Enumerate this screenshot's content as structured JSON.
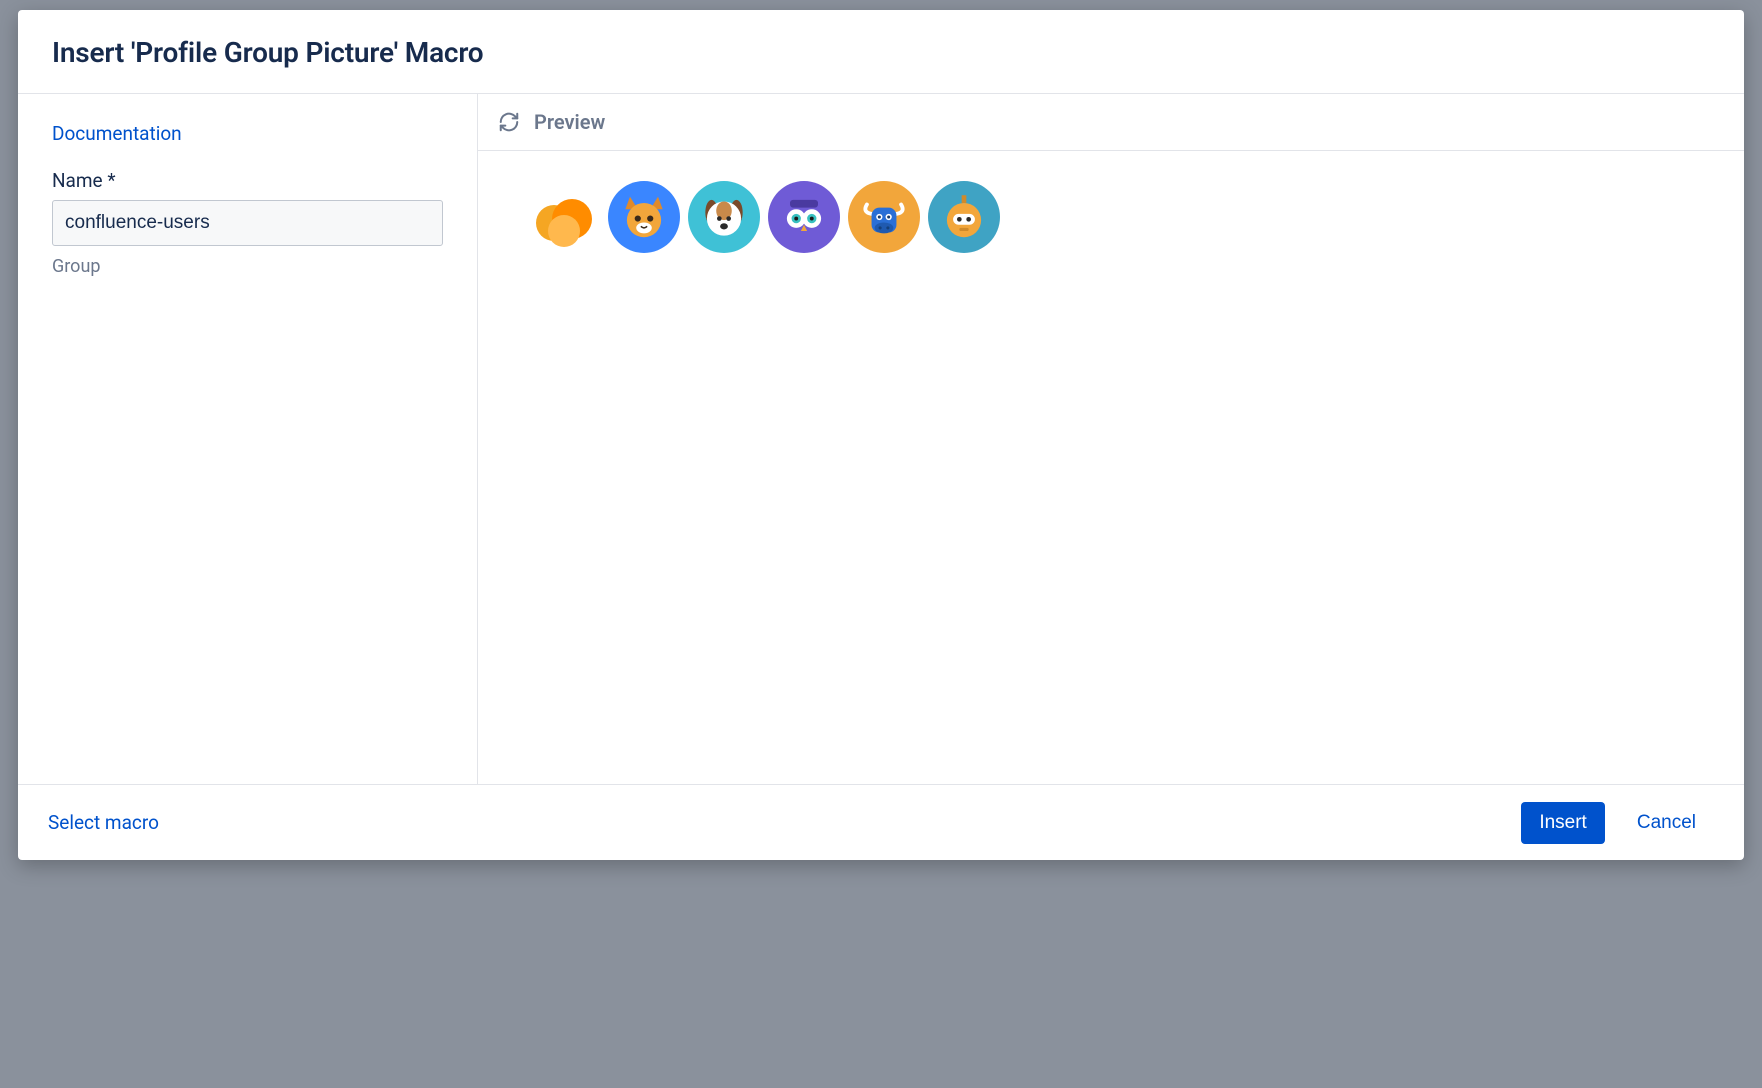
{
  "dialog": {
    "title": "Insert 'Profile Group Picture' Macro"
  },
  "form": {
    "documentation_link": "Documentation",
    "name_label": "Name *",
    "name_value": "confluence-users",
    "name_help": "Group"
  },
  "preview": {
    "heading": "Preview",
    "avatars": [
      {
        "name": "cloud-avatar",
        "bg": "transparent"
      },
      {
        "name": "cat-avatar",
        "bg": "#3a86ff"
      },
      {
        "name": "dog-avatar",
        "bg": "#3fc1d6"
      },
      {
        "name": "owl-avatar",
        "bg": "#6f5bd6"
      },
      {
        "name": "bull-avatar",
        "bg": "#f2a63b"
      },
      {
        "name": "robot-avatar",
        "bg": "#3fa3c4"
      }
    ]
  },
  "footer": {
    "select_macro": "Select macro",
    "insert": "Insert",
    "cancel": "Cancel"
  }
}
